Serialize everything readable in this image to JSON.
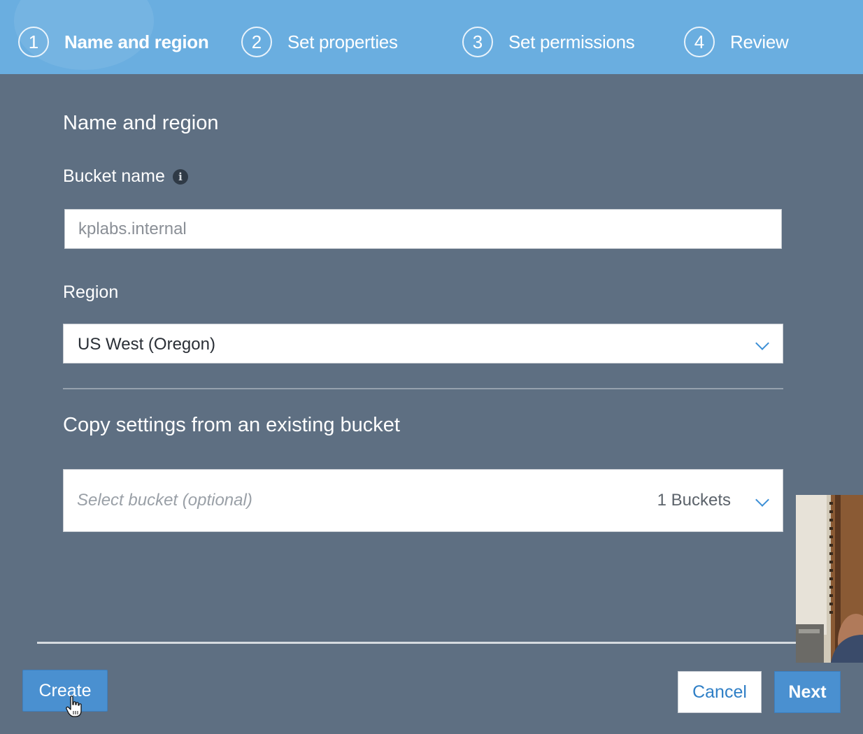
{
  "wizard": {
    "steps": [
      {
        "number": "1",
        "label": "Name and region",
        "active": true
      },
      {
        "number": "2",
        "label": "Set properties",
        "active": false
      },
      {
        "number": "3",
        "label": "Set permissions",
        "active": false
      },
      {
        "number": "4",
        "label": "Review",
        "active": false
      }
    ]
  },
  "form": {
    "section_title": "Name and region",
    "bucket_name": {
      "label": "Bucket name",
      "info_icon": "info-icon",
      "value": "kplabs.internal"
    },
    "region": {
      "label": "Region",
      "selected": "US West (Oregon)"
    },
    "copy_settings": {
      "title": "Copy settings from an existing bucket",
      "placeholder": "Select bucket (optional)",
      "count": "1 Buckets"
    }
  },
  "footer": {
    "create_label": "Create",
    "cancel_label": "Cancel",
    "next_label": "Next"
  },
  "colors": {
    "header": "#6aaee0",
    "background": "#5e6f82",
    "accent": "#4a90d0"
  }
}
